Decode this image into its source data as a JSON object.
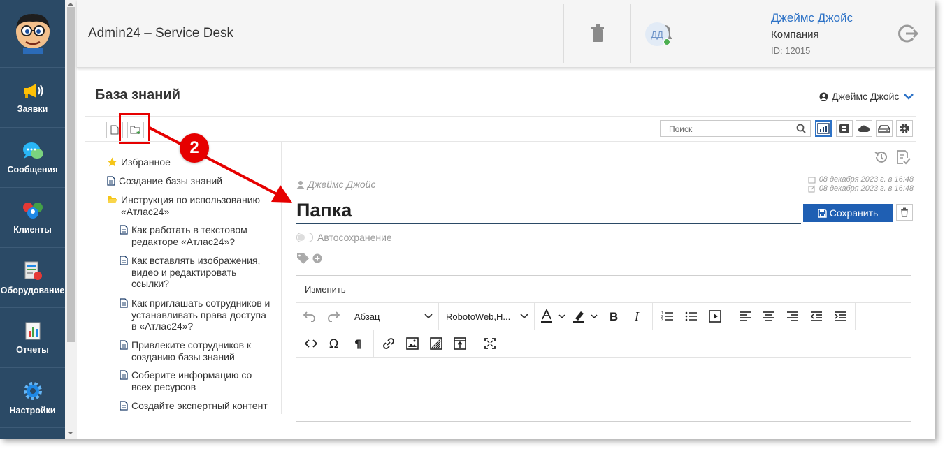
{
  "nav": {
    "items": [
      {
        "label": "Заявки",
        "icon": "megaphone-icon"
      },
      {
        "label": "Сообщения",
        "icon": "chat-icon"
      },
      {
        "label": "Клиенты",
        "icon": "clients-icon"
      },
      {
        "label": "Оборудование",
        "icon": "equipment-icon"
      },
      {
        "label": "Отчеты",
        "icon": "reports-icon"
      },
      {
        "label": "Настройки",
        "icon": "gear-icon"
      }
    ]
  },
  "header": {
    "title": "Admin24 – Service Desk",
    "user_initials": "ДД",
    "user_name": "Джеймс Джойс",
    "company": "Компания",
    "user_id": "ID: 12015"
  },
  "page": {
    "title": "База знаний",
    "current_user": "Джеймс Джойс"
  },
  "search": {
    "placeholder": "Поиск"
  },
  "tree": {
    "favorites": "Избранное",
    "create_kb": "Создание базы знаний",
    "folder": "Инструкция по использованию «Атлас24»",
    "children": [
      "Как работать в текстовом редакторе «Атлас24»?",
      "Как вставлять изображения, видео и редактировать ссылки?",
      "Как приглашать сотрудников и устанавливать права доступа в «Атлас24»?",
      "Привлеките сотрудников к созданию базы знаний",
      "Соберите информацию со всех ресурсов",
      "Создайте экспертный контент"
    ]
  },
  "article": {
    "author": "Джеймс Джойс",
    "created": "08 декабря 2023 г. в 16:48",
    "edited": "08 декабря 2023 г. в 16:48",
    "title": "Папка",
    "save_label": "Сохранить",
    "autosave_label": "Автосохранение"
  },
  "editor": {
    "menu_label": "Изменить",
    "block_format": "Абзац",
    "font_family": "RobotoWeb,H..."
  },
  "annotation": {
    "step": "2"
  },
  "colors": {
    "nav_bg": "#2b4a66",
    "accent": "#1f5fb3",
    "highlight": "#e60000"
  }
}
